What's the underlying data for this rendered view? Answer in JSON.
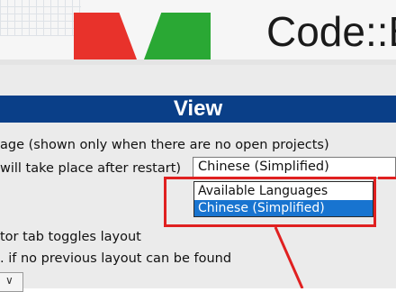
{
  "banner": {
    "app_title": "Code::B"
  },
  "dialog": {
    "section_title": "View",
    "language_label_line1": "age (shown only when there are no open projects)",
    "language_label_line2": "will take place after restart)",
    "language_combo_value": "Chinese (Simplified)",
    "language_options": [
      "Available Languages",
      "Chinese (Simplified)"
    ],
    "layout_toggle_label": "tor tab toggles layout",
    "layout_default_label": ". if no previous layout can be found"
  },
  "colors": {
    "header_bg": "#0a3f88",
    "selected_bg": "#1874d0",
    "highlight": "#e02020"
  },
  "icons": {
    "combo_arrow": "chevron-down-icon"
  }
}
